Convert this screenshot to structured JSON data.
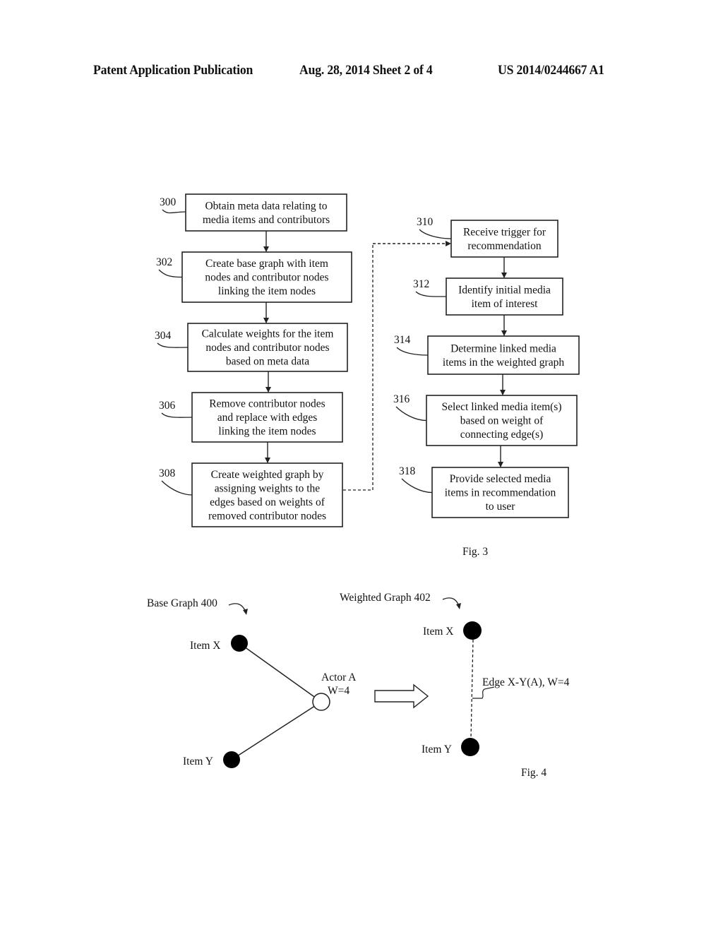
{
  "header": {
    "publication": "Patent Application Publication",
    "date_sheet": "Aug. 28, 2014  Sheet 2 of 4",
    "number": "US 2014/0244667 A1"
  },
  "fig3": {
    "caption": "Fig. 3",
    "steps": [
      {
        "ref": "300",
        "lines": [
          "Obtain meta data relating to",
          "media items and contributors"
        ]
      },
      {
        "ref": "302",
        "lines": [
          "Create base graph with item",
          "nodes and contributor nodes",
          "linking the item nodes"
        ]
      },
      {
        "ref": "304",
        "lines": [
          "Calculate weights for the item",
          "nodes and contributor nodes",
          "based on meta data"
        ]
      },
      {
        "ref": "306",
        "lines": [
          "Remove contributor nodes",
          "and replace with edges",
          "linking the item nodes"
        ]
      },
      {
        "ref": "308",
        "lines": [
          "Create weighted graph by",
          "assigning weights to the",
          "edges based on weights of",
          "removed contributor nodes"
        ]
      },
      {
        "ref": "310",
        "lines": [
          "Receive trigger for",
          "recommendation"
        ]
      },
      {
        "ref": "312",
        "lines": [
          "Identify initial media",
          "item of interest"
        ]
      },
      {
        "ref": "314",
        "lines": [
          "Determine linked media",
          "items in the weighted graph"
        ]
      },
      {
        "ref": "316",
        "lines": [
          "Select linked media item(s)",
          "based on weight of",
          "connecting edge(s)"
        ]
      },
      {
        "ref": "318",
        "lines": [
          "Provide selected media",
          "items in recommendation",
          "to user"
        ]
      }
    ]
  },
  "fig4": {
    "caption": "Fig. 4",
    "base_graph": {
      "title": "Base Graph 400",
      "item_x": "Item X",
      "item_y": "Item Y",
      "actor_name": "Actor A",
      "actor_weight": "W=4"
    },
    "weighted_graph": {
      "title": "Weighted Graph 402",
      "item_x": "Item X",
      "item_y": "Item Y",
      "edge_label": "Edge X-Y(A), W=4"
    }
  }
}
